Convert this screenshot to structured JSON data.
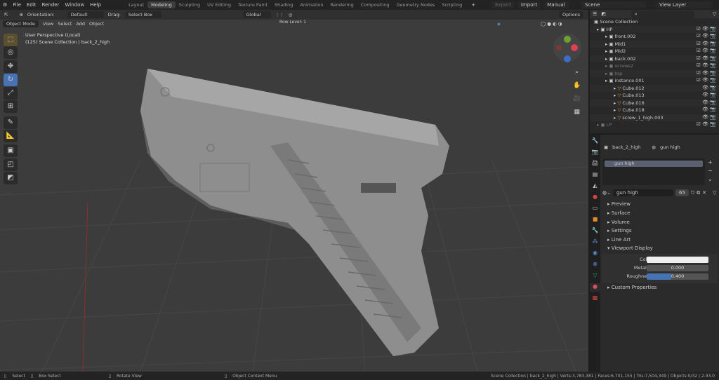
{
  "menu": [
    "File",
    "Edit",
    "Render",
    "Window",
    "Help"
  ],
  "workspaces": [
    "Layout",
    "Modeling",
    "Sculpting",
    "UV Editing",
    "Texture Paint",
    "Shading",
    "Animation",
    "Rendering",
    "Compositing",
    "Geometry Nodes",
    "Scripting"
  ],
  "active_workspace": "Modeling",
  "top_right": {
    "export": "Export",
    "import": "Import",
    "manual": "Manual",
    "scene": "Scene",
    "view_layer": "View Layer"
  },
  "tool_header": {
    "orientation_label": "Orientation:",
    "orientation": "Default",
    "drag_label": "Drag:",
    "drag": "Select Box",
    "transform": "Global",
    "options": "Options",
    "row_label": "Row Level: 1"
  },
  "viewport_header": {
    "mode": "Object Mode",
    "view": "View",
    "select": "Select",
    "add": "Add",
    "object": "Object"
  },
  "viewport": {
    "perspective": "User Perspective (Local)",
    "collection": "(125) Scene Collection | back_2_high"
  },
  "outliner": {
    "root": "Scene Collection",
    "items": [
      {
        "name": "HP",
        "level": 0
      },
      {
        "name": "front.002",
        "level": 1
      },
      {
        "name": "Mid1",
        "level": 1
      },
      {
        "name": "Mid2",
        "level": 1
      },
      {
        "name": "back.002",
        "level": 1
      },
      {
        "name": "screws2",
        "level": 1
      },
      {
        "name": "top",
        "level": 1
      },
      {
        "name": "instance.001",
        "level": 1
      },
      {
        "name": "Cube.012",
        "level": 2
      },
      {
        "name": "Cube.013",
        "level": 2
      },
      {
        "name": "Cube.016",
        "level": 2
      },
      {
        "name": "Cube.018",
        "level": 2
      },
      {
        "name": "screw_1_high.003",
        "level": 2
      },
      {
        "name": "LP",
        "level": 0
      }
    ]
  },
  "properties": {
    "object": "back_2_high",
    "material": "gun high",
    "slot": "gun high",
    "material_name": "gun high",
    "users": "65",
    "panels": [
      "Preview",
      "Surface",
      "Volume",
      "Settings",
      "Line Art",
      "Viewport Display",
      "Custom Properties"
    ],
    "color_label": "Color",
    "metallic_label": "Metallic",
    "metallic": "0.000",
    "roughness_label": "Roughness",
    "roughness": "0.400",
    "roughness_fraction": 0.4
  },
  "status": {
    "select": "Select",
    "box_select": "Box Select",
    "rotate": "Rotate View",
    "context": "Object Context Menu",
    "stats": "Scene Collection | back_2_high | Verts:3,783,381 | Faces:6,701,155 | Tris:7,504,349 | Objects:0/32 | 2.93.0"
  }
}
